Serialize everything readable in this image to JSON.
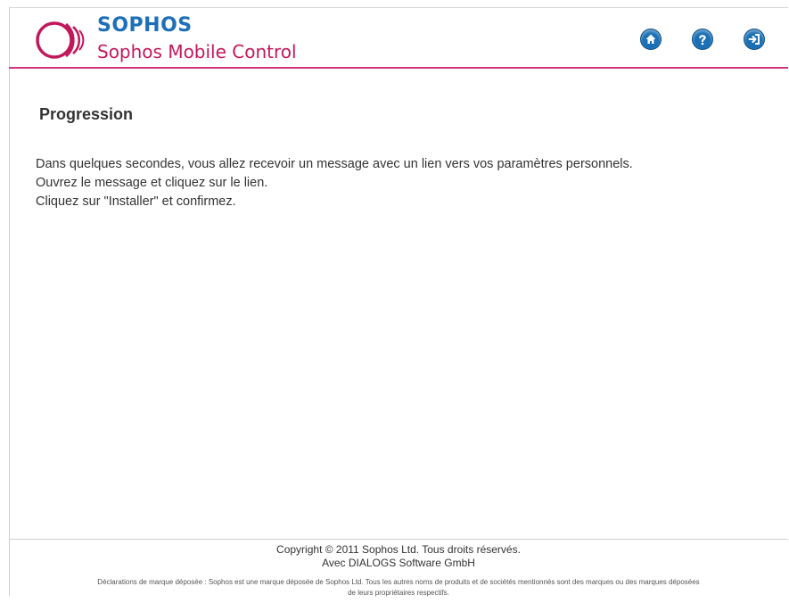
{
  "header": {
    "brand": "SOPHOS",
    "product": "Sophos Mobile Control",
    "icons": {
      "home": "home-icon",
      "help": "help-icon",
      "logout": "logout-icon"
    },
    "colors": {
      "brand_blue": "#1d6fb8",
      "accent_pink": "#c2185b",
      "divider": "#d0357a",
      "icon_blue": "#1a6fb5"
    }
  },
  "main": {
    "title": "Progression",
    "messages": [
      "Dans quelques secondes, vous allez recevoir un message avec un lien vers vos paramètres personnels.",
      "Ouvrez le message et cliquez sur le lien.",
      "Cliquez sur \"Installer\" et confirmez."
    ]
  },
  "footer": {
    "copyright": "Copyright © 2011 Sophos Ltd. Tous droits réservés.",
    "partner": "Avec DIALOGS Software GmbH",
    "legal_line1": "Déclarations de marque déposée : Sophos est une marque déposée de Sophos Ltd. Tous les autres noms de produits et de sociétés mentionnés sont des marques ou des marques déposées",
    "legal_line2": "de leurs propriétaires respectifs."
  }
}
